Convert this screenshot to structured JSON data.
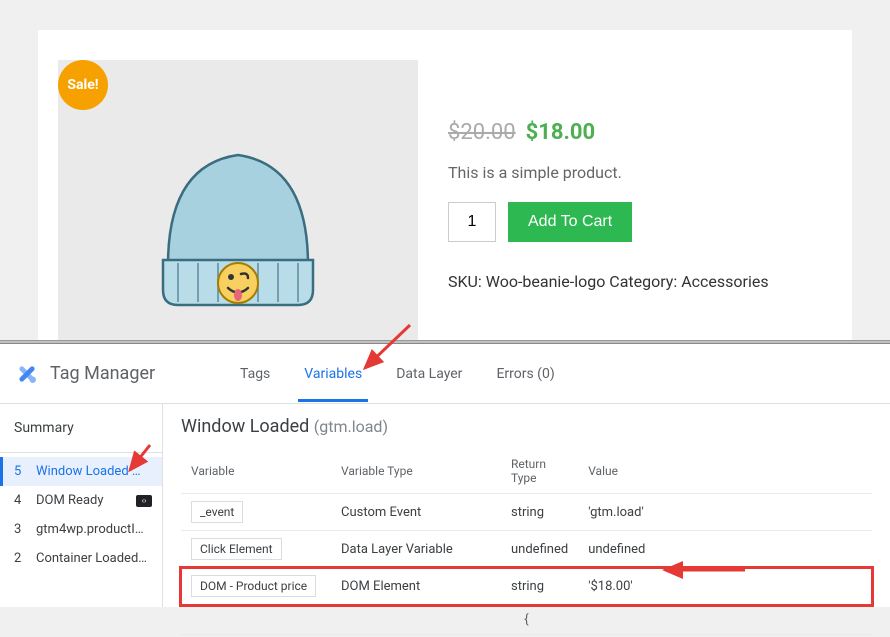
{
  "product": {
    "sale_badge": "Sale!",
    "old_price": "$20.00",
    "new_price": "$18.00",
    "description": "This is a simple product.",
    "qty": "1",
    "add_to_cart": "Add To Cart",
    "sku_label": "SKU:",
    "sku_value": "Woo-beanie-logo",
    "category_label": "Category:",
    "category_value": "Accessories"
  },
  "gtm": {
    "title": "Tag Manager",
    "tabs": {
      "tags": "Tags",
      "variables": "Variables",
      "data_layer": "Data Layer",
      "errors": "Errors (0)"
    },
    "sidebar": {
      "summary": "Summary",
      "events": [
        {
          "num": "5",
          "name": "Window Loaded …",
          "active": true
        },
        {
          "num": "4",
          "name": "DOM Ready",
          "icon": true
        },
        {
          "num": "3",
          "name": "gtm4wp.productI…"
        },
        {
          "num": "2",
          "name": "Container Loaded…"
        }
      ]
    },
    "main": {
      "title": "Window Loaded",
      "subtitle": "(gtm.load)",
      "headers": {
        "variable": "Variable",
        "type": "Variable Type",
        "return": "Return Type",
        "value": "Value"
      },
      "rows": [
        {
          "variable": "_event",
          "type": "Custom Event",
          "return": "string",
          "value": "'gtm.load'"
        },
        {
          "variable": "Click Element",
          "type": "Data Layer Variable",
          "return": "undefined",
          "value": "undefined"
        },
        {
          "variable": "DOM - Product price",
          "type": "DOM Element",
          "return": "string",
          "value": "'$18.00'",
          "highlight": true
        }
      ],
      "brace": "{"
    }
  }
}
